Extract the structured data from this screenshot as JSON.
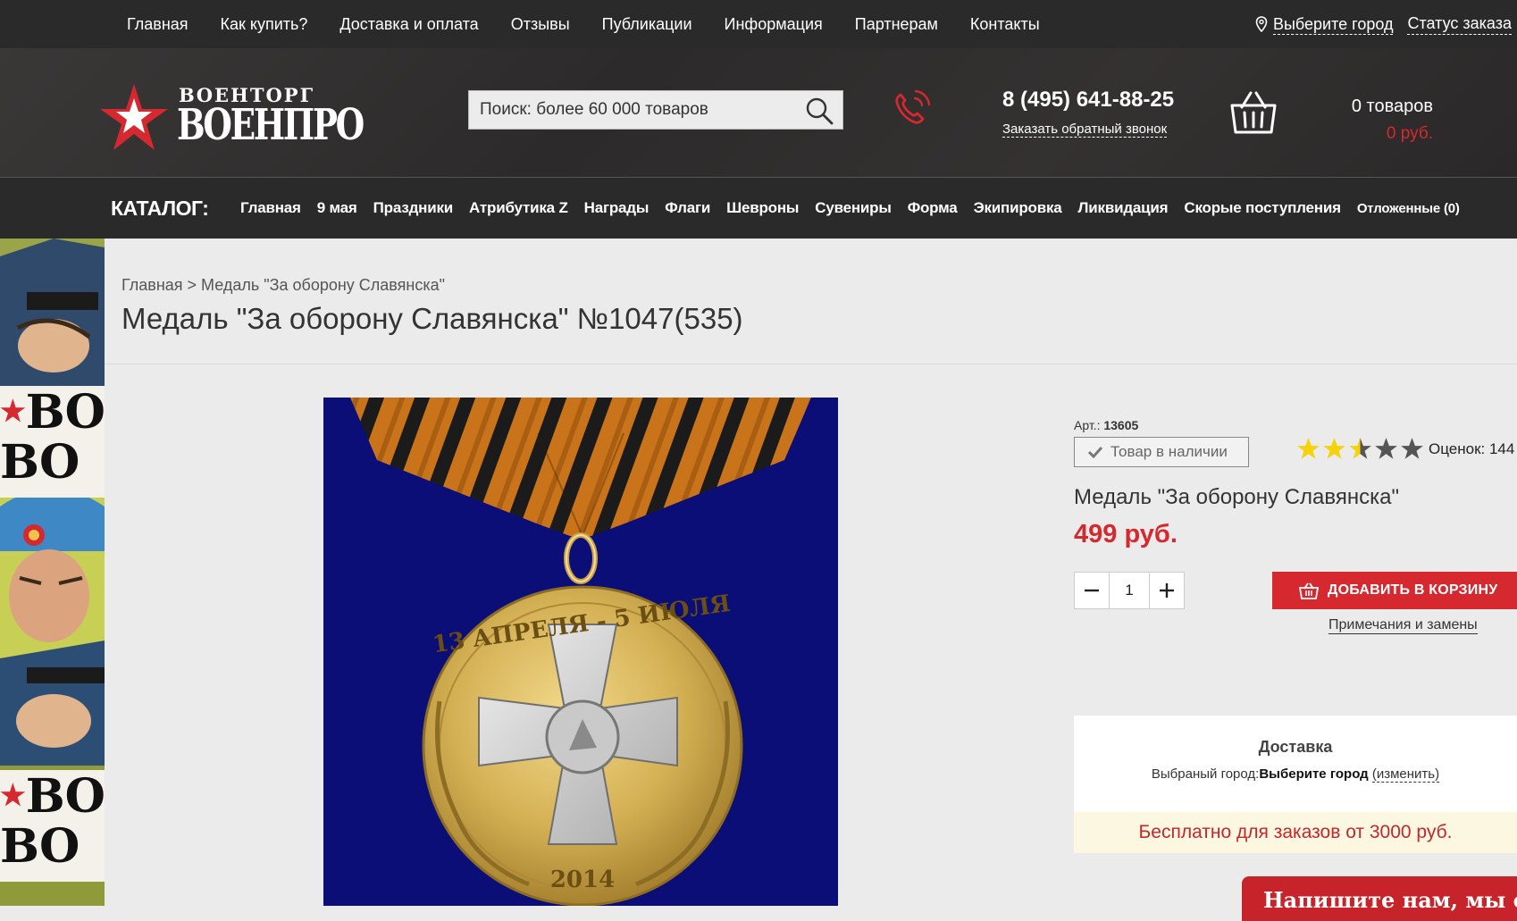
{
  "topnav": {
    "items": [
      "Главная",
      "Как купить?",
      "Доставка и оплата",
      "Отзывы",
      "Публикации",
      "Информация",
      "Партнерам",
      "Контакты"
    ],
    "city": "Выберите город",
    "status": "Статус заказа"
  },
  "header": {
    "logo_top": "ВОЕНТОРГ",
    "logo_big": "ВОЕНПРО",
    "search_placeholder": "Поиск: более 60 000 товаров",
    "phone": "8 (495) 641-88-25",
    "callback": "Заказать обратный звонок",
    "cart_count": "0 товаров",
    "cart_sum": "0 руб."
  },
  "catalog": {
    "label": "КАТАЛОГ:",
    "items": [
      "Главная",
      "9 мая",
      "Праздники",
      "Атрибутика Z",
      "Награды",
      "Флаги",
      "Шевроны",
      "Сувениры",
      "Форма",
      "Экипировка",
      "Ликвидация",
      "Скорые поступления"
    ],
    "postponed": "Отложенные (0)"
  },
  "banner": {
    "text_line1": "ВО",
    "text_line2": "ВО"
  },
  "page": {
    "breadcrumb": "Главная > Медаль \"За оборону Славянска\"",
    "title": "Медаль \"За оборону Славянска\" №1047(535)"
  },
  "product": {
    "art_label": "Арт.:",
    "art_value": "13605",
    "stock": "Товар в наличии",
    "rating_stars": 2.5,
    "rating_max": 5,
    "rating_text": "Оценок: 144",
    "name": "Медаль \"За оборону Славянска\"",
    "price": "499 руб.",
    "qty": "1",
    "add_to_cart": "ДОБАВИТЬ В КОРЗИНУ",
    "notes": "Примечания и замены",
    "medal_text_top": "13 АПРЕЛЯ - 5 ИЮЛЯ",
    "medal_year": "2014"
  },
  "delivery": {
    "title": "Доставка",
    "city_label": "Выбраный город:",
    "city_value": "Выберите город",
    "change": "(изменить)",
    "free": "Бесплатно для заказов от 3000 руб."
  },
  "chat": {
    "text": "Напишите нам, мы онлайн"
  },
  "colors": {
    "accent": "#d6282f",
    "dark_bar": "#2b2a2a",
    "medal_bg": "#0c0e78",
    "star": "#f5d20a"
  }
}
